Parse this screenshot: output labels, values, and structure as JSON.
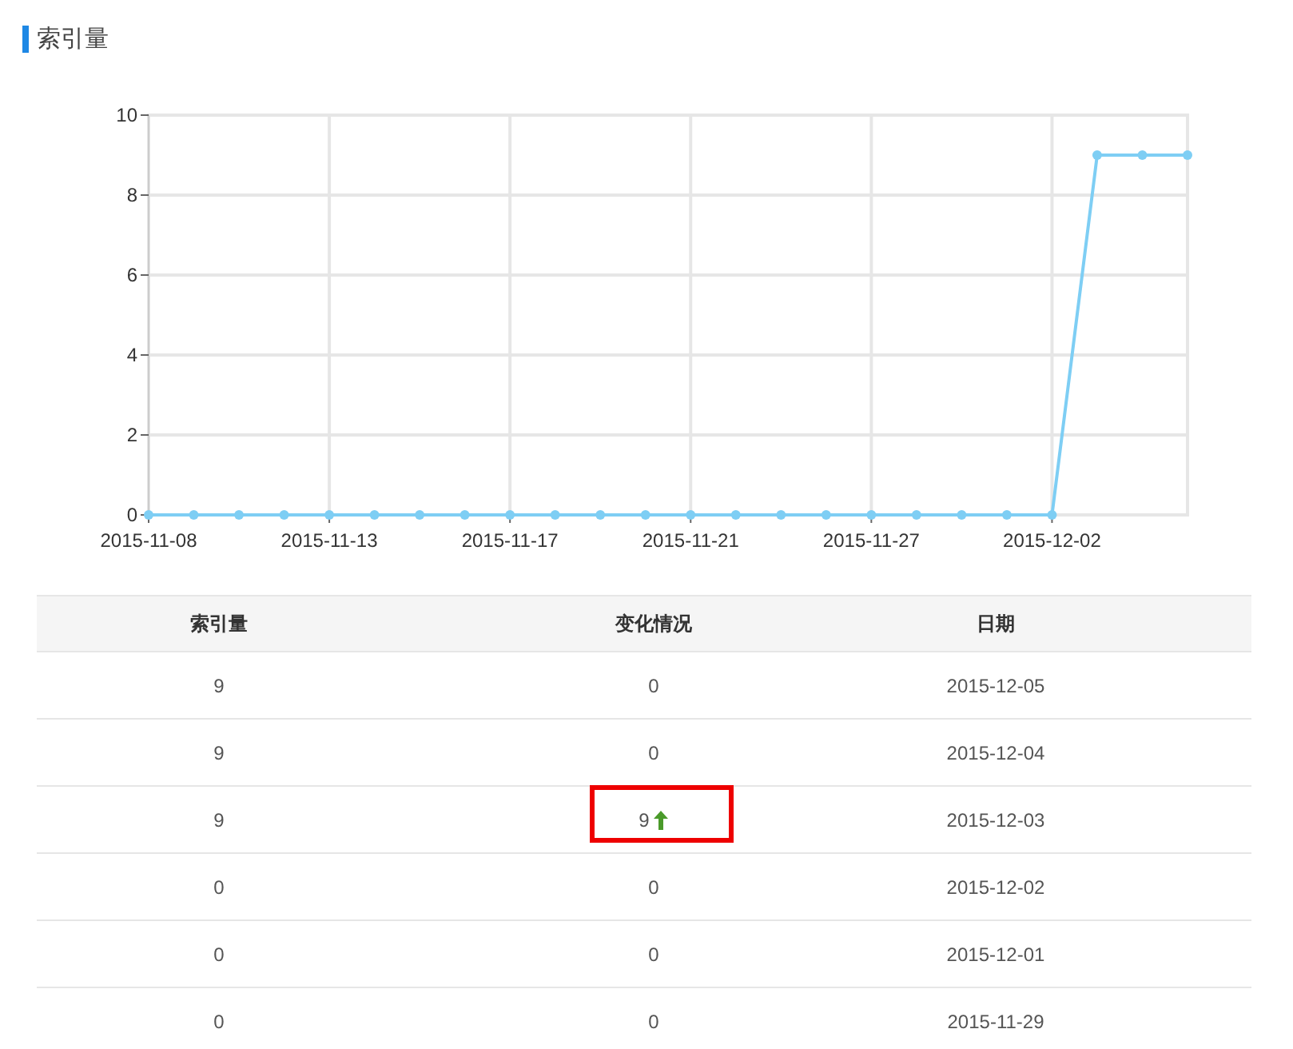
{
  "section": {
    "title": "索引量"
  },
  "chart": {
    "chart_data": {
      "type": "line",
      "categories": [
        "2015-11-08",
        null,
        null,
        null,
        "2015-11-13",
        null,
        null,
        null,
        "2015-11-17",
        null,
        null,
        null,
        "2015-11-21",
        null,
        null,
        null,
        "2015-11-27",
        null,
        null,
        null,
        "2015-12-02",
        null,
        null,
        null
      ],
      "grid": true,
      "series": [
        {
          "color": "#7ecef4",
          "marker": true,
          "values": [
            0,
            0,
            0,
            0,
            0,
            0,
            0,
            0,
            0,
            0,
            0,
            0,
            0,
            0,
            0,
            0,
            0,
            0,
            0,
            0,
            0,
            9,
            9,
            9
          ]
        }
      ],
      "ylim": [
        0,
        10
      ],
      "yticks": [
        0,
        2,
        4,
        6,
        8,
        10
      ]
    }
  },
  "table": {
    "columns": [
      "索引量",
      "变化情况",
      "日期"
    ],
    "rows": [
      {
        "index": "9",
        "change": "0",
        "rising": false,
        "date": "2015-12-05",
        "highlighted": false
      },
      {
        "index": "9",
        "change": "0",
        "rising": false,
        "date": "2015-12-04",
        "highlighted": false
      },
      {
        "index": "9",
        "change": "9",
        "rising": true,
        "date": "2015-12-03",
        "highlighted": true
      },
      {
        "index": "0",
        "change": "0",
        "rising": false,
        "date": "2015-12-02",
        "highlighted": false
      },
      {
        "index": "0",
        "change": "0",
        "rising": false,
        "date": "2015-12-01",
        "highlighted": false
      },
      {
        "index": "0",
        "change": "0",
        "rising": false,
        "date": "2015-11-29",
        "highlighted": false
      }
    ]
  }
}
